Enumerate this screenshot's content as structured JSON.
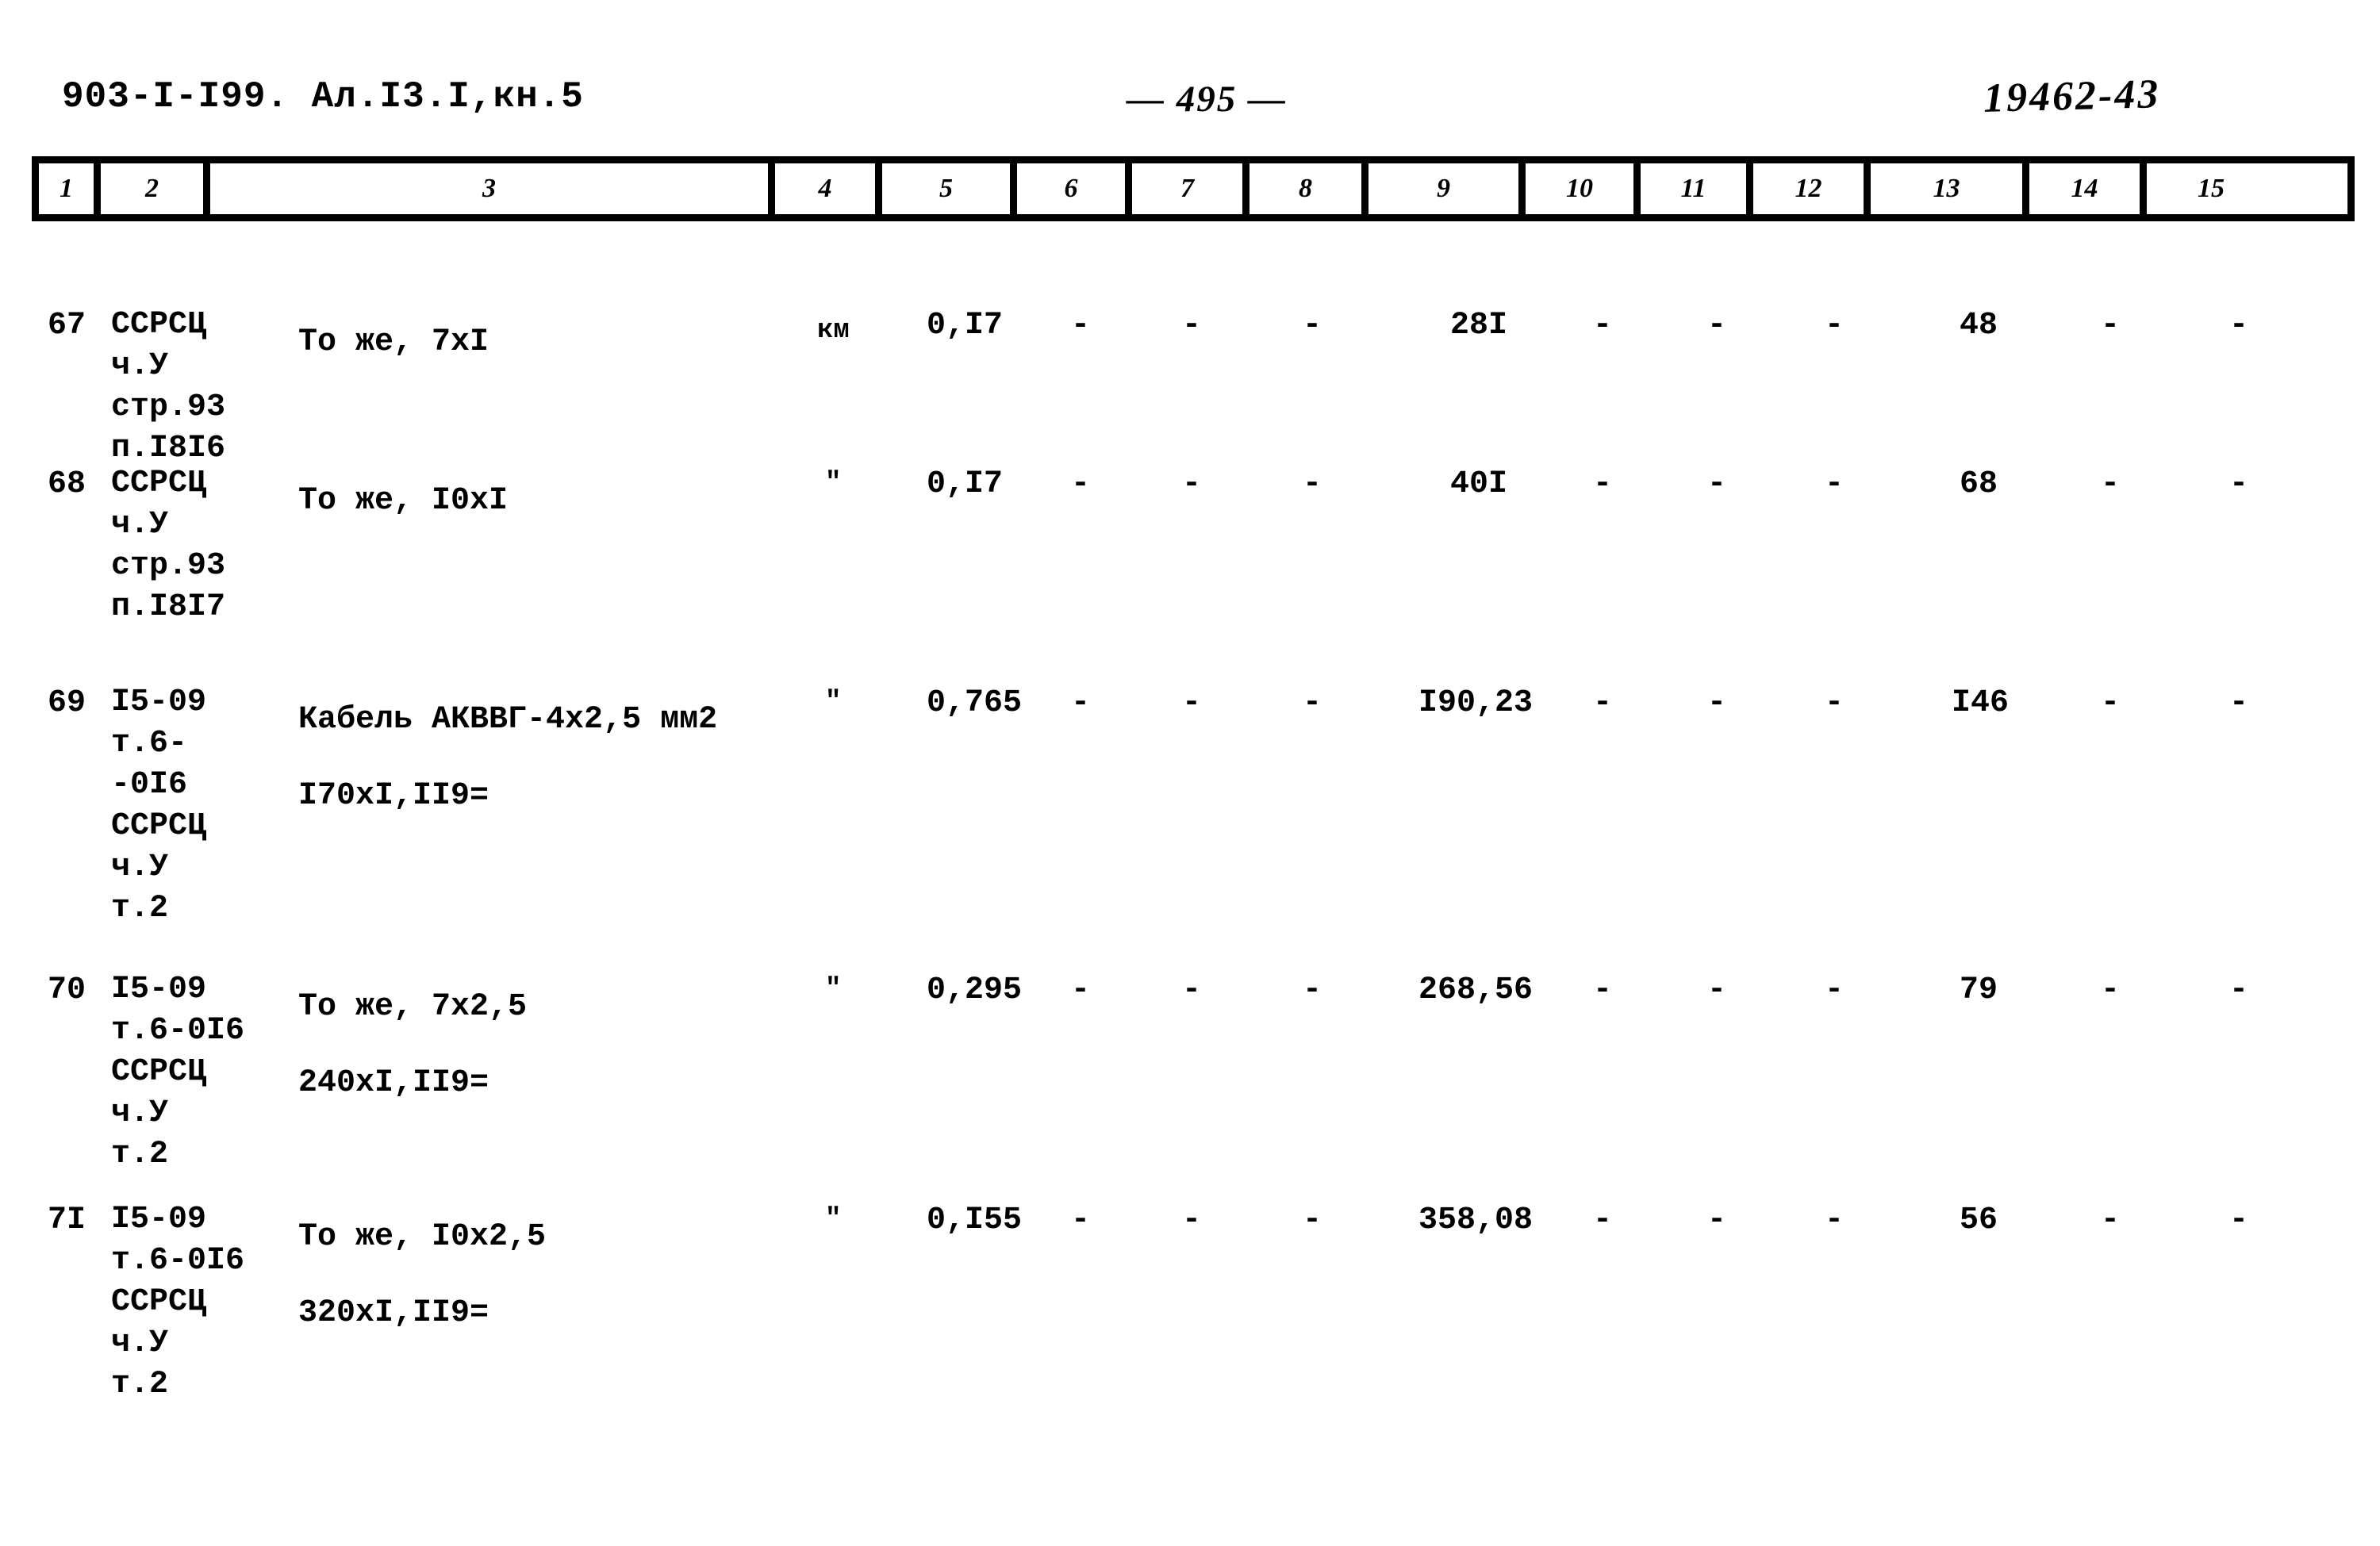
{
  "header": {
    "doc_code": "903-I-I99. Ал.I3.I,кн.5",
    "page_number": "— 495 —",
    "stamp_number": "19462-43"
  },
  "table": {
    "column_headers": [
      "1",
      "2",
      "3",
      "4",
      "5",
      "6",
      "7",
      "8",
      "9",
      "10",
      "11",
      "12",
      "13",
      "14",
      "15"
    ],
    "rows": [
      {
        "no": "67",
        "code_lines": "ССРСЦ\nч.У\nстр.93\nп.I8I6",
        "description_lines": "То же, 7хI",
        "unit": "км",
        "c5": "0,I7",
        "c6": "-",
        "c7": "-",
        "c8": "-",
        "c9": "28I",
        "c10": "-",
        "c11": "-",
        "c12": "-",
        "c13": "48",
        "c14": "-",
        "c15": "-"
      },
      {
        "no": "68",
        "code_lines": "ССРСЦ\nч.У\nстр.93\nп.I8I7",
        "description_lines": "То же, I0хI",
        "unit": "\"",
        "c5": "0,I7",
        "c6": "-",
        "c7": "-",
        "c8": "-",
        "c9": "40I",
        "c10": "-",
        "c11": "-",
        "c12": "-",
        "c13": "68",
        "c14": "-",
        "c15": "-"
      },
      {
        "no": "69",
        "code_lines": "I5-09\nт.6-\n-0I6\nССРСЦ\nч.У\nт.2",
        "description_lines": "Кабель АКВВГ-4х2,5 мм2\nI70хI,II9=",
        "unit": "\"",
        "c5": "0,765",
        "c6": "-",
        "c7": "-",
        "c8": "-",
        "c9": "I90,23",
        "c10": "-",
        "c11": "-",
        "c12": "-",
        "c13": "I46",
        "c14": "-",
        "c15": "-"
      },
      {
        "no": "70",
        "code_lines": "I5-09\nт.6-0I6\nССРСЦ\nч.У\nт.2",
        "description_lines": "То же, 7х2,5\n240хI,II9=",
        "unit": "\"",
        "c5": "0,295",
        "c6": "-",
        "c7": "-",
        "c8": "-",
        "c9": "268,56",
        "c10": "-",
        "c11": "-",
        "c12": "-",
        "c13": "79",
        "c14": "-",
        "c15": "-"
      },
      {
        "no": "7I",
        "code_lines": "I5-09\nт.6-0I6\nССРСЦ\nч.У\nт.2",
        "description_lines": "То же, I0х2,5\n320хI,II9=",
        "unit": "\"",
        "c5": "0,I55",
        "c6": "-",
        "c7": "-",
        "c8": "-",
        "c9": "358,08",
        "c10": "-",
        "c11": "-",
        "c12": "-",
        "c13": "56",
        "c14": "-",
        "c15": "-"
      }
    ]
  }
}
